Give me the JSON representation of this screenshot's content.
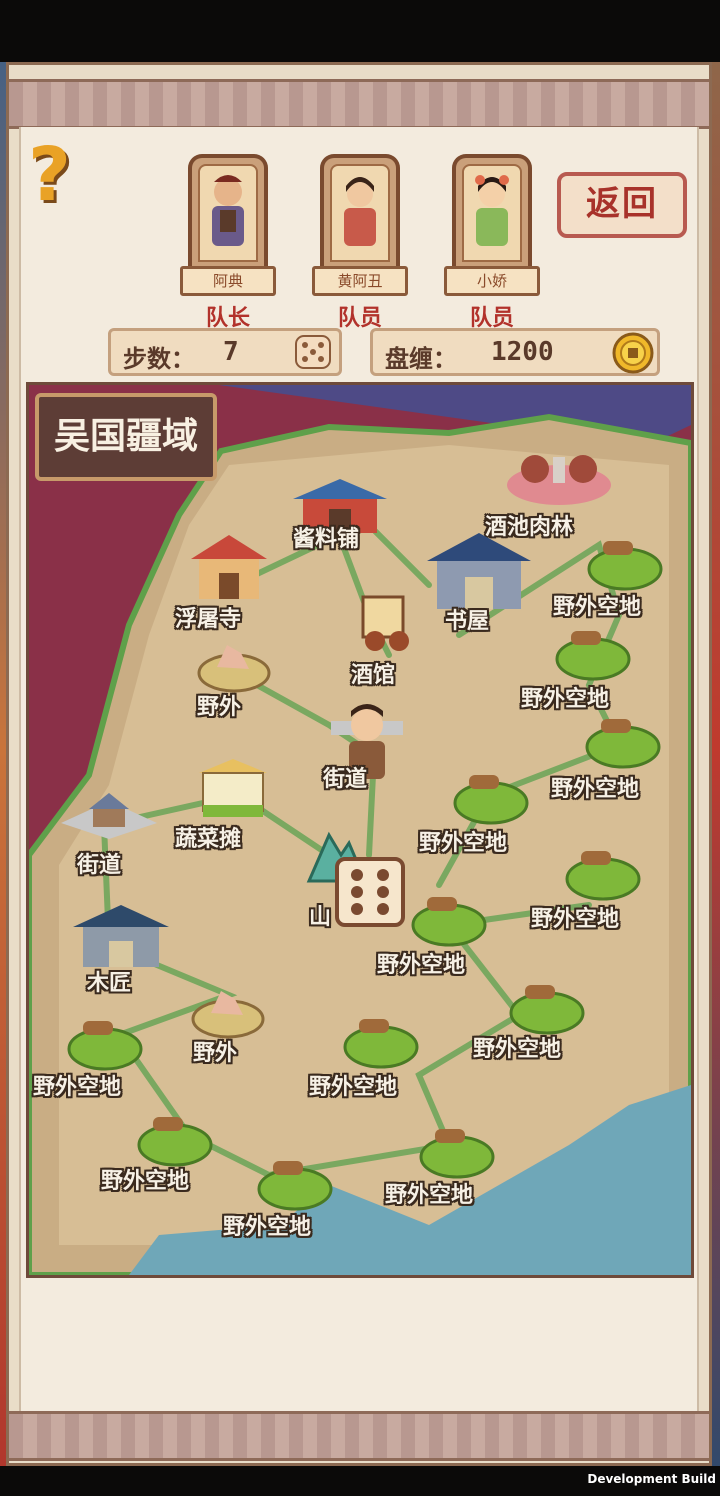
{
  "team": {
    "members": [
      {
        "name": "阿典",
        "role": "队长"
      },
      {
        "name": "黄阿丑",
        "role": "队员"
      },
      {
        "name": "小娇",
        "role": "队员"
      }
    ]
  },
  "return_button": "返回",
  "help_icon": "question-mark-icon",
  "stats": {
    "steps_label": "步数：",
    "steps_value": "7",
    "money_label": "盘缠：",
    "money_value": "1200"
  },
  "map": {
    "region_title": "吴国疆域",
    "locations": [
      "酱料铺",
      "酒池肉林",
      "浮屠寺",
      "书屋",
      "野外空地",
      "酒馆",
      "野外",
      "野外空地",
      "街道",
      "野外空地",
      "蔬菜摊",
      "野外空地",
      "街道",
      "山",
      "野外空地",
      "木匠",
      "野外空地",
      "野外",
      "野外空地",
      "野外空地",
      "野外空地",
      "野外空地",
      "野外空地"
    ]
  },
  "footer": {
    "build_label": "Development Build"
  },
  "colors": {
    "accent_red": "#b2322b",
    "gold": "#e9a226",
    "map_land": "#d7be95",
    "grass": "#7fb83a",
    "path": "#7aa860"
  }
}
